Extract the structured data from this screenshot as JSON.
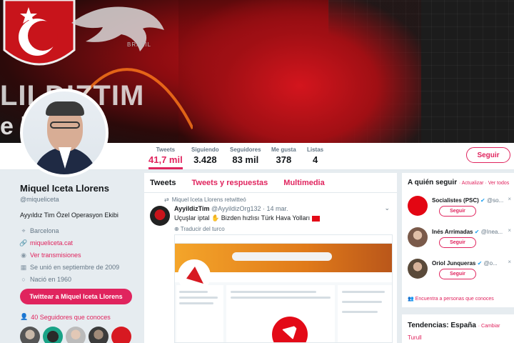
{
  "banner": {
    "text_line1": "LILDIZTIM",
    "text_line2": "e l  iz!",
    "map_label": "BRAZIL"
  },
  "nav": {
    "stats": [
      {
        "label": "Tweets",
        "value": "41,7 mil",
        "active": true
      },
      {
        "label": "Siguiendo",
        "value": "3.428"
      },
      {
        "label": "Seguidores",
        "value": "83 mil"
      },
      {
        "label": "Me gusta",
        "value": "378"
      },
      {
        "label": "Listas",
        "value": "4"
      }
    ],
    "follow_label": "Seguir"
  },
  "profile": {
    "name": "Miquel Iceta Llorens",
    "handle": "@miqueliceta",
    "bio": "Ayyıldız Tim Özel Operasyon Ekibi",
    "location": "Barcelona",
    "website": "miqueliceta.cat",
    "broadcasts": "Ver transmisiones",
    "joined": "Se unió en septiembre de 2009",
    "born": "Nació en 1960",
    "tweet_to_label": "Twittear a Miquel Iceta Llorens",
    "known_followers": "40 Seguidores que conoces"
  },
  "timeline": {
    "tabs": [
      "Tweets",
      "Tweets y respuestas",
      "Multimedia"
    ],
    "retweet_note": "Miquel Iceta Llorens retwitteó",
    "tweet": {
      "author": "AyyildizTim",
      "author_handle": "@AyyildizOrg132 · 14 mar.",
      "text": "Uçuşlar iptal ✋ Bizden hızlısı Türk Hava Yolları",
      "translate": "Traducir del turco"
    }
  },
  "who_to_follow": {
    "title": "A quién seguir",
    "links": "· Actualizar · Ver todos",
    "items": [
      {
        "name": "Socialistes (PSC)",
        "handle": "@so...",
        "button": "Seguir",
        "color": "#e30613"
      },
      {
        "name": "Inés Arrimadas",
        "handle": "@Inea...",
        "button": "Seguir",
        "color": "#7a5a4a"
      },
      {
        "name": "Oriol Junqueras",
        "handle": "@o...",
        "button": "Seguir",
        "color": "#5a4a3a"
      }
    ],
    "find_people": "Encuentra a personas que conoces"
  },
  "trends": {
    "title": "Tendencias: España",
    "change": "· Cambiar",
    "first": "Turull"
  },
  "colors": {
    "accent": "#e0245e",
    "banner_red": "#c8141b"
  }
}
